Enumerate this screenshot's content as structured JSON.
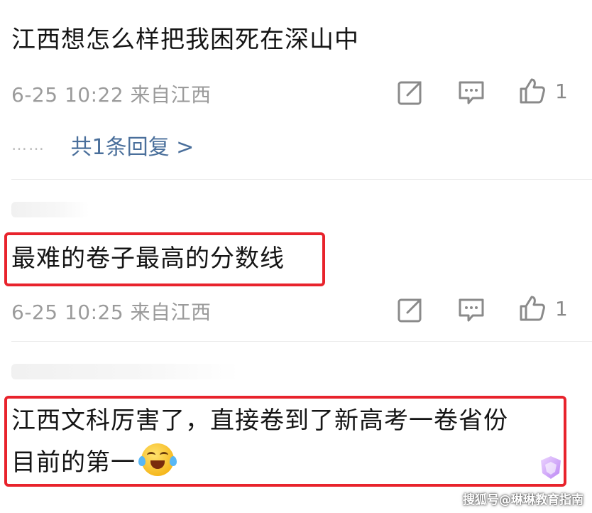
{
  "comments": [
    {
      "text": "江西想怎么样把我困死在深山中",
      "meta": "6-25 10:22 来自江西",
      "likes": "1",
      "replies_label": "共1条回复 >"
    },
    {
      "text": "最难的卷子最高的分数线",
      "meta": "6-25 10:25 来自江西",
      "likes": "1"
    },
    {
      "text_line1": "江西文科厉害了，直接卷到了新高考一卷省份",
      "text_line2": "目前的第一",
      "emoji": "laughing-crying-emoji"
    }
  ],
  "replies_dots": "……",
  "watermark": "搜狐号@琳琳教育指南",
  "colors": {
    "highlight": "#e8232c",
    "link": "#4a6f9b",
    "meta": "#9b9b9b"
  },
  "icons": [
    "share-icon",
    "comment-icon",
    "like-icon",
    "badge-icon"
  ]
}
